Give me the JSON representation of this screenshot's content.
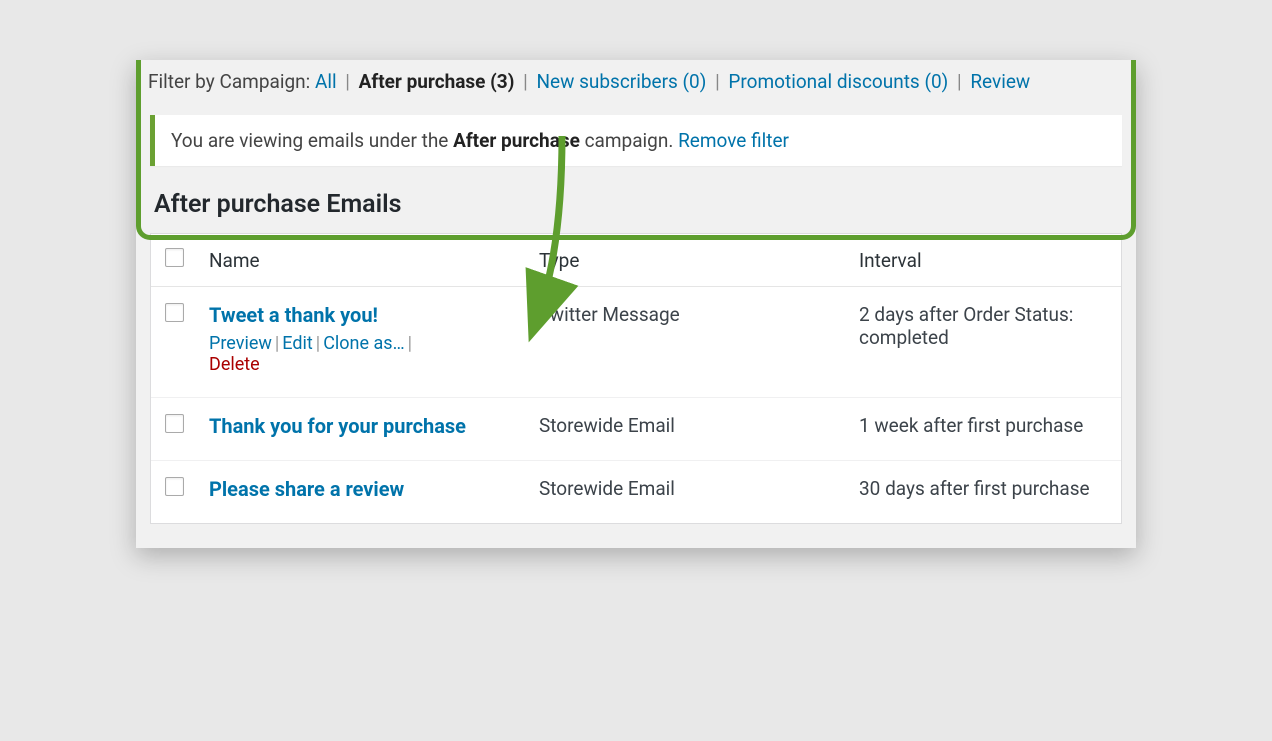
{
  "filter": {
    "label": "Filter by Campaign:",
    "all": "All",
    "current": "After purchase (3)",
    "items": [
      "New subscribers (0)",
      "Promotional discounts (0)",
      "Review"
    ]
  },
  "notice": {
    "prefix": "You are viewing emails under the ",
    "campaign": "After purchase",
    "suffix": " campaign. ",
    "remove": "Remove filter"
  },
  "section_title": "After purchase Emails",
  "columns": {
    "name": "Name",
    "type": "Type",
    "interval": "Interval"
  },
  "actions": {
    "preview": "Preview",
    "edit": "Edit",
    "clone": "Clone as…",
    "delete": "Delete"
  },
  "rows": [
    {
      "name": "Tweet a thank you!",
      "type": "Twitter Message",
      "interval": "2 days after Order Status: completed",
      "show_actions": true
    },
    {
      "name": "Thank you for your purchase",
      "type": "Storewide Email",
      "interval": "1 week after first purchase",
      "show_actions": false
    },
    {
      "name": "Please share a review",
      "type": "Storewide Email",
      "interval": "30 days after first purchase",
      "show_actions": false
    }
  ]
}
